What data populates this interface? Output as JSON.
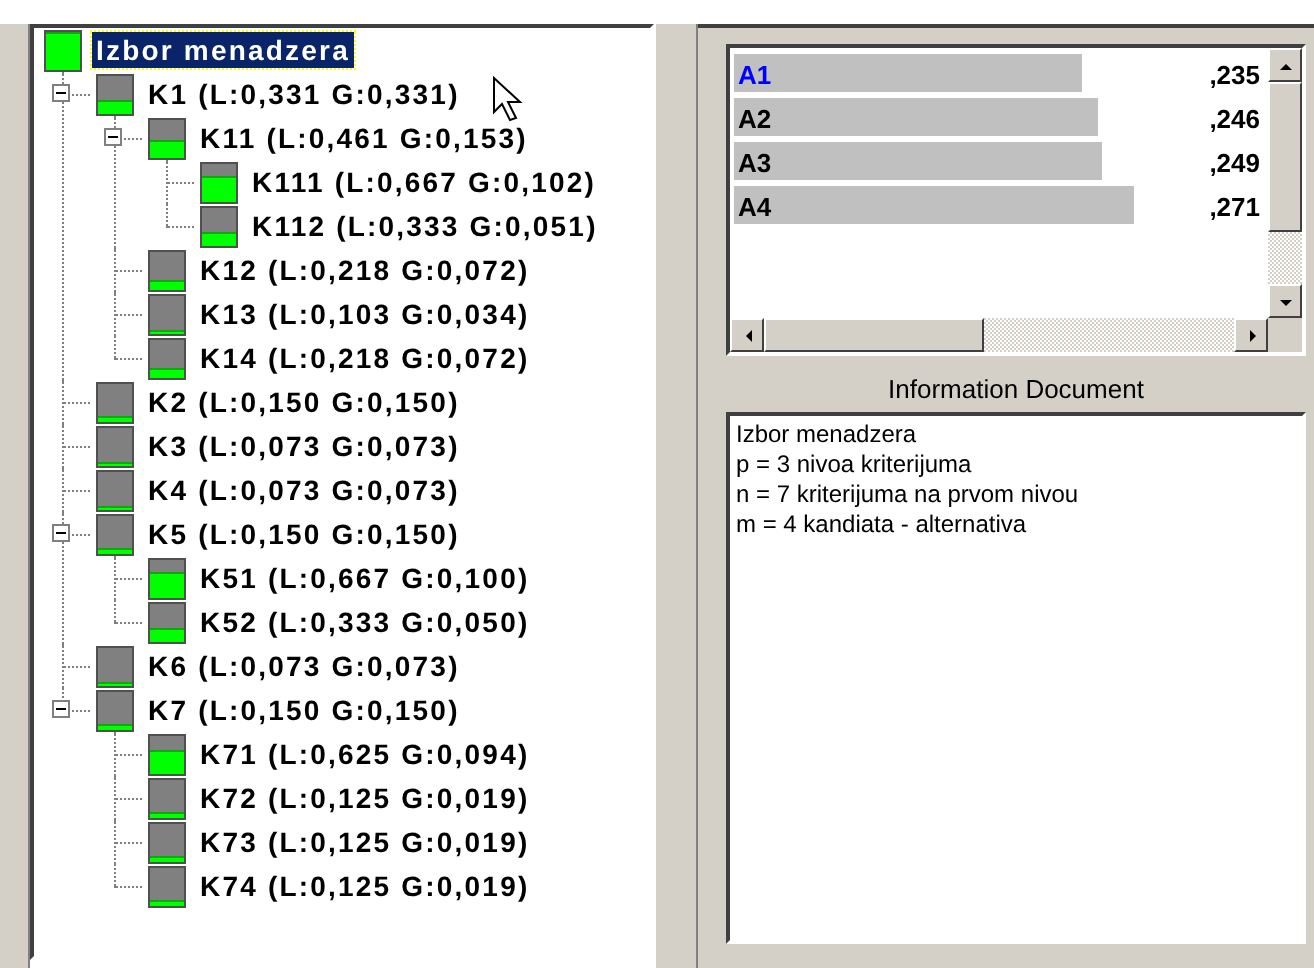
{
  "tree": {
    "label": "Izbor menadzera",
    "level": 1,
    "selected": true,
    "children": [
      {
        "label": "K1 (L:0,331 G:0,331)",
        "level": 0.331,
        "selected": false,
        "expanded": true,
        "children": [
          {
            "label": "K11 (L:0,461 G:0,153)",
            "level": 0.461,
            "selected": false,
            "expanded": true,
            "children": [
              {
                "label": "K111 (L:0,667 G:0,102)",
                "level": 0.667,
                "selected": false
              },
              {
                "label": "K112 (L:0,333 G:0,051)",
                "level": 0.333,
                "selected": false
              }
            ]
          },
          {
            "label": "K12 (L:0,218 G:0,072)",
            "level": 0.218,
            "selected": false
          },
          {
            "label": "K13 (L:0,103 G:0,034)",
            "level": 0.103,
            "selected": false
          },
          {
            "label": "K14 (L:0,218 G:0,072)",
            "level": 0.218,
            "selected": false
          }
        ]
      },
      {
        "label": "K2 (L:0,150 G:0,150)",
        "level": 0.15,
        "selected": false
      },
      {
        "label": "K3 (L:0,073 G:0,073)",
        "level": 0.073,
        "selected": false
      },
      {
        "label": "K4 (L:0,073 G:0,073)",
        "level": 0.073,
        "selected": false
      },
      {
        "label": "K5 (L:0,150 G:0,150)",
        "level": 0.15,
        "selected": false,
        "expanded": true,
        "children": [
          {
            "label": "K51 (L:0,667 G:0,100)",
            "level": 0.667,
            "selected": false
          },
          {
            "label": "K52 (L:0,333 G:0,050)",
            "level": 0.333,
            "selected": false
          }
        ]
      },
      {
        "label": "K6 (L:0,073 G:0,073)",
        "level": 0.073,
        "selected": false
      },
      {
        "label": "K7 (L:0,150 G:0,150)",
        "level": 0.15,
        "selected": false,
        "expanded": true,
        "children": [
          {
            "label": "K71 (L:0,625 G:0,094)",
            "level": 0.625,
            "selected": false
          },
          {
            "label": "K72 (L:0,125 G:0,019)",
            "level": 0.125,
            "selected": false
          },
          {
            "label": "K73 (L:0,125 G:0,019)",
            "level": 0.125,
            "selected": false
          },
          {
            "label": "K74 (L:0,125 G:0,019)",
            "level": 0.125,
            "selected": false
          }
        ]
      }
    ]
  },
  "alternatives": [
    {
      "name": "A1",
      "value": ",235",
      "level": 0.65,
      "selected": true
    },
    {
      "name": "A2",
      "value": ",246",
      "level": 0.68,
      "selected": false
    },
    {
      "name": "A3",
      "value": ",249",
      "level": 0.69,
      "selected": false
    },
    {
      "name": "A4",
      "value": ",271",
      "level": 0.75,
      "selected": false
    }
  ],
  "info": {
    "title": "Information Document",
    "lines": [
      "Izbor menadzera",
      "p = 3 nivoa kriterijuma",
      "n = 7 kriterijuma na prvom nivou",
      "m = 4 kandiata - alternativa"
    ]
  }
}
